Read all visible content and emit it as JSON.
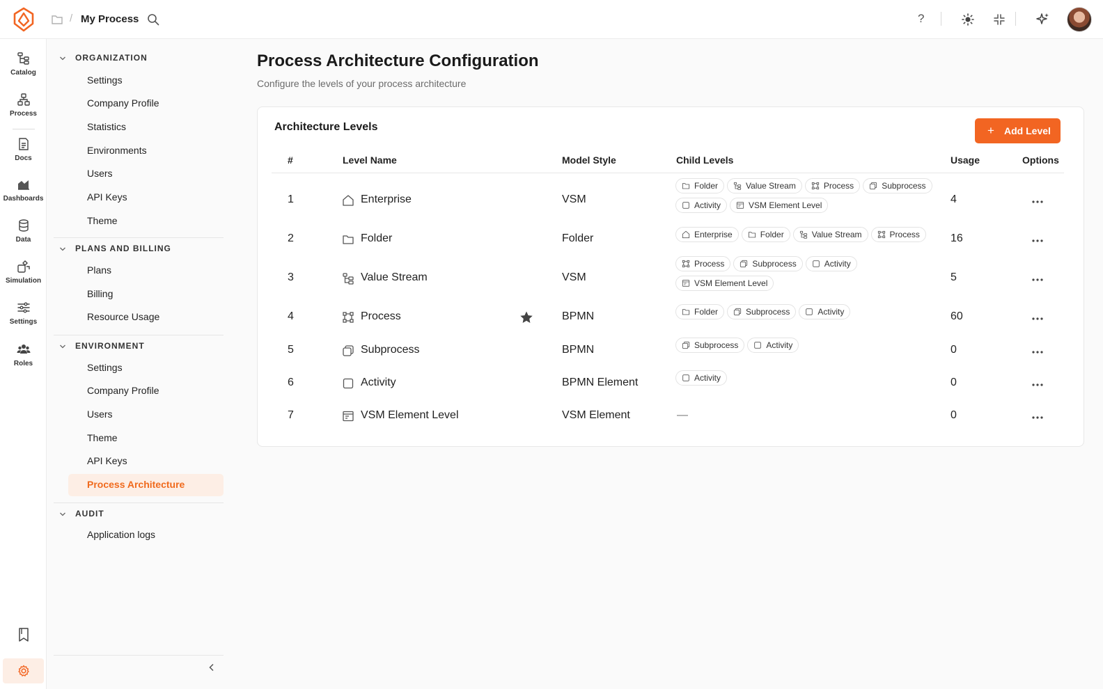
{
  "topbar": {
    "title": "My Process",
    "help": "?"
  },
  "rail": [
    {
      "label": "Catalog"
    },
    {
      "label": "Process"
    },
    {
      "label": "Docs"
    },
    {
      "label": "Dashboards"
    },
    {
      "label": "Data"
    },
    {
      "label": "Simulation"
    },
    {
      "label": "Settings"
    },
    {
      "label": "Roles"
    }
  ],
  "sidebar": {
    "groups": [
      {
        "title": "ORGANIZATION",
        "items": [
          "Settings",
          "Company Profile",
          "Statistics",
          "Environments",
          "Users",
          "API Keys",
          "Theme"
        ]
      },
      {
        "title": "PLANS AND BILLING",
        "items": [
          "Plans",
          "Billing",
          "Resource Usage"
        ]
      },
      {
        "title": "ENVIRONMENT",
        "items": [
          "Settings",
          "Company Profile",
          "Users",
          "Theme",
          "API Keys",
          "Process Architecture"
        ]
      },
      {
        "title": "AUDIT",
        "items": [
          "Application logs"
        ]
      }
    ],
    "active": "Process Architecture"
  },
  "page": {
    "title": "Process Architecture Configuration",
    "subtitle": "Configure the levels of your process architecture"
  },
  "card": {
    "title": "Architecture Levels",
    "add_button": "Add Level",
    "columns": [
      "#",
      "Level Name",
      "Model Style",
      "Child Levels",
      "Usage",
      "Options"
    ],
    "rows": [
      {
        "num": "1",
        "icon": "home-icon",
        "name": "Enterprise",
        "style": "VSM",
        "usage": "4",
        "starred": false,
        "children": [
          "Folder",
          "Value Stream",
          "Process",
          "Subprocess",
          "Activity",
          "VSM Element Level"
        ]
      },
      {
        "num": "2",
        "icon": "folder-icon",
        "name": "Folder",
        "style": "Folder",
        "usage": "16",
        "starred": false,
        "children": [
          "Enterprise",
          "Folder",
          "Value Stream",
          "Process"
        ]
      },
      {
        "num": "3",
        "icon": "value-stream-icon",
        "name": "Value Stream",
        "style": "VSM",
        "usage": "5",
        "starred": false,
        "children": [
          "Process",
          "Subprocess",
          "Activity",
          "VSM Element Level"
        ]
      },
      {
        "num": "4",
        "icon": "process-icon",
        "name": "Process",
        "style": "BPMN",
        "usage": "60",
        "starred": true,
        "children": [
          "Folder",
          "Subprocess",
          "Activity"
        ]
      },
      {
        "num": "5",
        "icon": "subprocess-icon",
        "name": "Subprocess",
        "style": "BPMN",
        "usage": "0",
        "starred": false,
        "children": [
          "Subprocess",
          "Activity"
        ]
      },
      {
        "num": "6",
        "icon": "activity-icon",
        "name": "Activity",
        "style": "BPMN Element",
        "usage": "0",
        "starred": false,
        "children": [
          "Activity"
        ]
      },
      {
        "num": "7",
        "icon": "vsm-element-icon",
        "name": "VSM Element Level",
        "style": "VSM Element",
        "usage": "0",
        "starred": false,
        "children": [],
        "children_empty": "—"
      }
    ]
  },
  "colors": {
    "accent": "#f26522",
    "active_bg": "#fdeee5"
  }
}
